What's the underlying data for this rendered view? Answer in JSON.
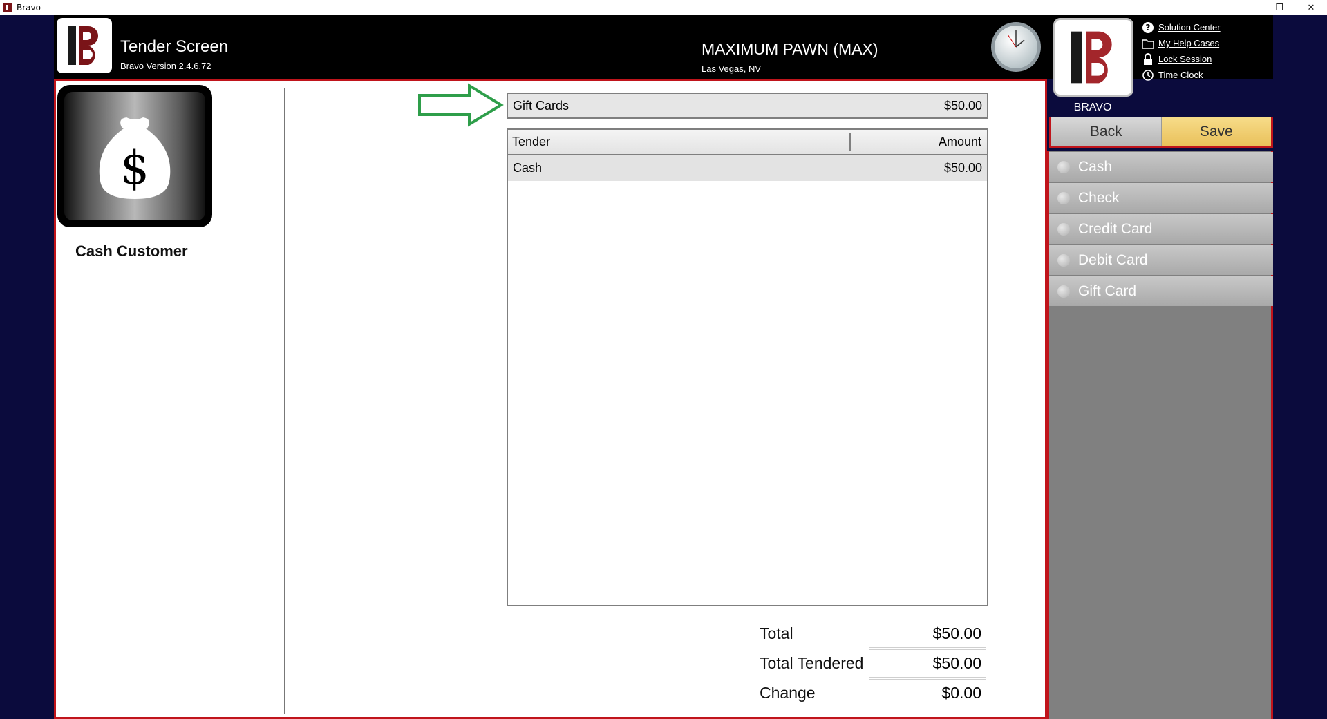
{
  "window": {
    "title": "Bravo",
    "minimize": "–",
    "restore": "❐",
    "close": "✕"
  },
  "header": {
    "screen_title": "Tender Screen",
    "version": "Bravo Version 2.4.6.72",
    "store_name": "MAXIMUM PAWN (MAX)",
    "store_location": "Las Vegas, NV",
    "bravo_label": "BRAVO",
    "links": [
      {
        "label": "Solution Center",
        "icon": "help-icon"
      },
      {
        "label": "My Help Cases",
        "icon": "folder-icon"
      },
      {
        "label": "Lock Session",
        "icon": "lock-icon"
      },
      {
        "label": "Time Clock",
        "icon": "clock-icon"
      }
    ]
  },
  "customer": {
    "name": "Cash Customer",
    "icon": "money-bag-icon"
  },
  "gift_cards": {
    "label": "Gift Cards",
    "amount": "$50.00"
  },
  "tender_grid": {
    "columns": [
      "Tender",
      "Amount"
    ],
    "rows": [
      {
        "tender": "Cash",
        "amount": "$50.00"
      }
    ]
  },
  "totals": {
    "total_label": "Total",
    "total_value": "$50.00",
    "tendered_label": "Total Tendered",
    "tendered_value": "$50.00",
    "change_label": "Change",
    "change_value": "$0.00"
  },
  "nav": {
    "back": "Back",
    "save": "Save"
  },
  "tender_options": [
    "Cash",
    "Check",
    "Credit Card",
    "Debit Card",
    "Gift Card"
  ],
  "colors": {
    "accent_red": "#c0141b",
    "save_yellow": "#e9c05a",
    "arrow_green": "#2e9e4a",
    "frame_navy": "#0b0b3d"
  }
}
